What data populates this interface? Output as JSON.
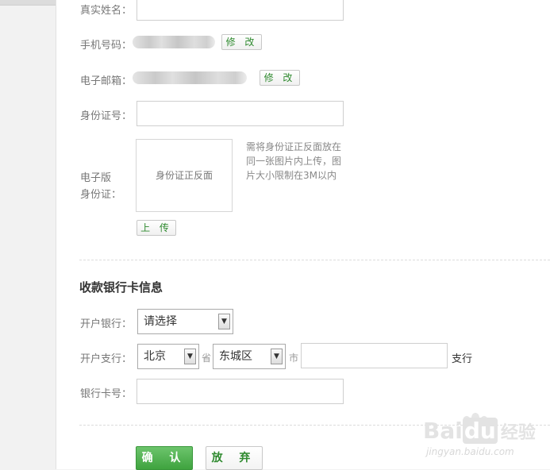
{
  "form": {
    "real_name_label": "真实姓名：",
    "phone_label": "手机号码：",
    "phone_modify": "修 改",
    "email_label": "电子邮箱：",
    "email_modify": "修 改",
    "id_label": "身份证号：",
    "id_value": "",
    "eid_label_line1": "电子版",
    "eid_label_line2": "身份证：",
    "eid_placeholder": "身份证正反面",
    "eid_note": "需将身份证正反面放在同一张图片内上传，图片大小限制在3M以内",
    "upload": "上 传"
  },
  "bank": {
    "title": "收款银行卡信息",
    "bank_label": "开户银行：",
    "bank_select": "请选择",
    "branch_label": "开户支行：",
    "province": "北京",
    "province_suffix": "省",
    "city": "东城区",
    "city_suffix": "市",
    "branch_input": "",
    "branch_suffix": "支行",
    "card_label": "银行卡号：",
    "card_value": ""
  },
  "actions": {
    "confirm": "确 认",
    "cancel": "放 弃"
  },
  "watermark": {
    "brand_a": "Bai",
    "brand_b": "du",
    "brand_c": "经验",
    "url": "jingyan.baidu.com"
  },
  "colors": {
    "accent_green": "#3fa33f",
    "link_green": "#2f8a2f"
  }
}
